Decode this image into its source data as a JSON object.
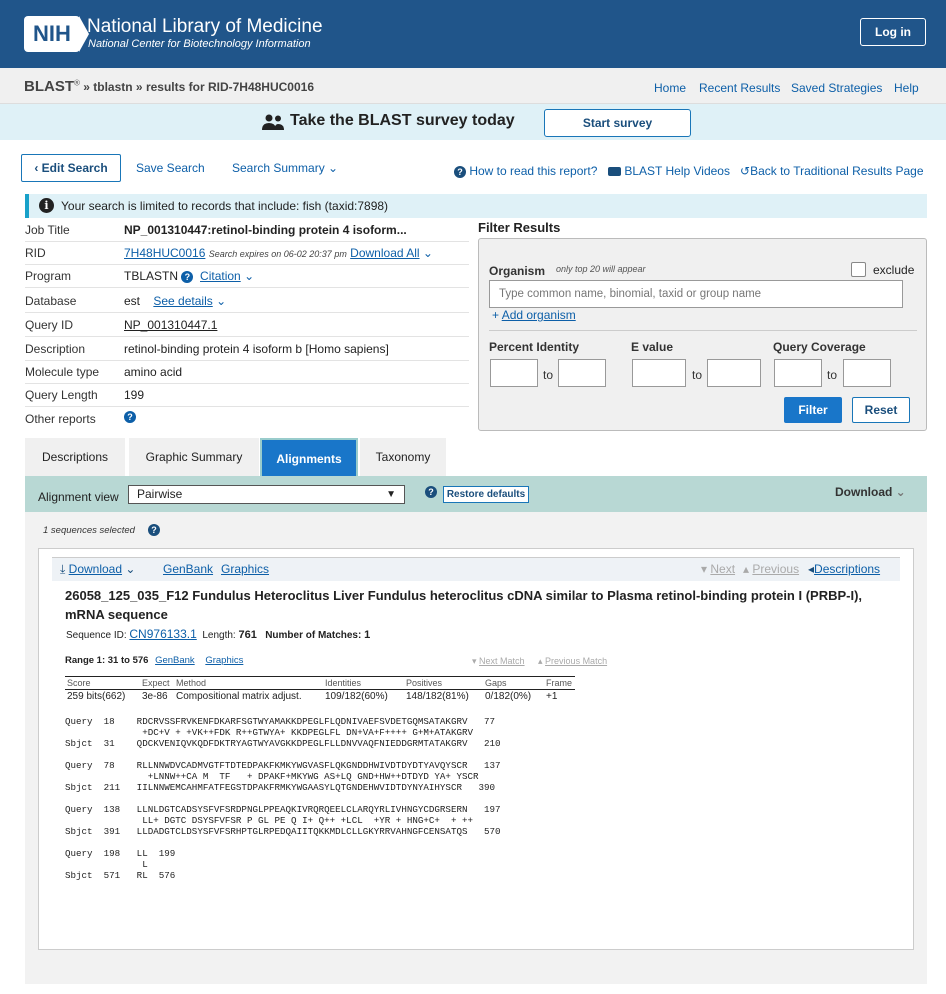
{
  "header": {
    "badge": "NIH",
    "title": "National Library of Medicine",
    "subtitle": "National Center for Biotechnology Information",
    "login": "Log in"
  },
  "crumb": {
    "blast": "BLAST",
    "reg": "®",
    "program": " » tblastn » ",
    "results": "results for RID-7H48HUC0016"
  },
  "topnav": [
    "Home",
    "Recent Results",
    "Saved Strategies",
    "Help"
  ],
  "survey": {
    "text": "Take the BLAST survey today",
    "button": "Start survey"
  },
  "toolbar": {
    "edit": "Edit Search",
    "save": "Save Search",
    "summary": "Search Summary",
    "how_to": "How to read this report?",
    "videos": "BLAST Help Videos",
    "back": "Back to Traditional Results Page"
  },
  "notice": "Your search is limited to records that include: fish (taxid:7898)",
  "meta": {
    "job_title_label": "Job Title",
    "job_title": "NP_001310447:retinol-binding protein 4 isoform...",
    "rid_label": "RID",
    "rid": "7H48HUC0016",
    "rid_expires": "Search expires on 06-02 20:37 pm",
    "download_all": "Download All",
    "program_label": "Program",
    "program": "TBLASTN",
    "citation": "Citation",
    "database_label": "Database",
    "database": "est",
    "see_details": "See details",
    "query_id_label": "Query ID",
    "query_id": "NP_001310447.1",
    "description_label": "Description",
    "description": "retinol-binding protein 4 isoform b [Homo sapiens]",
    "molecule_label": "Molecule type",
    "molecule": "amino acid",
    "query_length_label": "Query Length",
    "query_length": "199",
    "other_reports_label": "Other reports"
  },
  "filter": {
    "title": "Filter Results",
    "organism_label": "Organism",
    "organism_note": "only top 20 will appear",
    "exclude": "exclude",
    "organism_placeholder": "Type common  name, binomial, taxid or group  name",
    "add_organism": "Add organism",
    "percent_identity": "Percent Identity",
    "e_value": "E value",
    "query_coverage": "Query Coverage",
    "to": "to",
    "filter_btn": "Filter",
    "reset_btn": "Reset"
  },
  "tabs": [
    "Descriptions",
    "Graphic Summary",
    "Alignments",
    "Taxonomy"
  ],
  "alignment_view": {
    "label": "Alignment view",
    "selected": "Pairwise",
    "restore": "Restore defaults",
    "download": "Download"
  },
  "selected_count": "1 sequences selected",
  "hit": {
    "download": "Download",
    "genbank": "GenBank",
    "graphics": "Graphics",
    "next": "Next",
    "previous": "Previous",
    "descriptions": "Descriptions",
    "title": "26058_125_035_F12 Fundulus Heteroclitus Liver Fundulus heteroclitus cDNA similar to Plasma retinol-binding protein I (PRBP-I), mRNA sequence",
    "seq_id_label": "Sequence ID:",
    "seq_id": "CN976133.1",
    "length_label": "Length:",
    "length": "761",
    "matches_label": "Number of Matches:",
    "matches": "1",
    "range": "Range 1: 31 to 576",
    "range_genbank": "GenBank",
    "range_graphics": "Graphics",
    "next_match": "Next Match",
    "previous_match": "Previous Match"
  },
  "score_table": {
    "headers": [
      "Score",
      "Expect",
      "Method",
      "Identities",
      "Positives",
      "Gaps",
      "Frame"
    ],
    "values": [
      "259 bits(662)",
      "3e-86",
      "Compositional matrix adjust.",
      "109/182(60%)",
      "148/182(81%)",
      "0/182(0%)",
      "+1"
    ]
  },
  "alignment_lines": [
    "Query  18    RDCRVSSFRVKENFDKARFSGTWYAMAKKDPEGLFLQDNIVAEFSVDETGQMSATAKGRV   77",
    "              +DC+V + +VK++FDK R++GTWYA+ KKDPEGLFL DN+VA+F++++ G+M+ATAKGRV",
    "Sbjct  31    QDCKVENIQVKQDFDKTRYAGTWYAVGKKDPEGLFLLDNVVAQFNIEDDGRMTATAKGRV   210",
    "",
    "Query  78    RLLNNWDVCADMVGTFTDTEDPAKFKMKYWGVASFLQKGNDDHWIVDTDYDTYAVQYSCR   137",
    "               +LNNW++CA M  TF   + DPAKF+MKYWG AS+LQ GND+HW++DTDYD YA+ YSCR",
    "Sbjct  211   IILNNWEMCAHMFATFEGSTDPAKFRMKYWGAASYLQTGNDEHWVIDTDYNYAIHYSCR   390",
    "",
    "Query  138   LLNLDGTCADSYSFVFSRDPNGLPPEAQKIVRQRQEELCLARQYRLIVHNGYCDGRSERN   197",
    "              LL+ DGTC DSYSFVFSR P GL PE Q I+ Q++ +LCL  +YR + HNG+C+  + ++",
    "Sbjct  391   LLDADGTCLDSYSFVFSRHPTGLRPEDQAIITQKKMDLCLLGKYRRVAHNGFCENSATQS   570",
    "",
    "Query  198   LL  199",
    "              L",
    "Sbjct  571   RL  576"
  ]
}
